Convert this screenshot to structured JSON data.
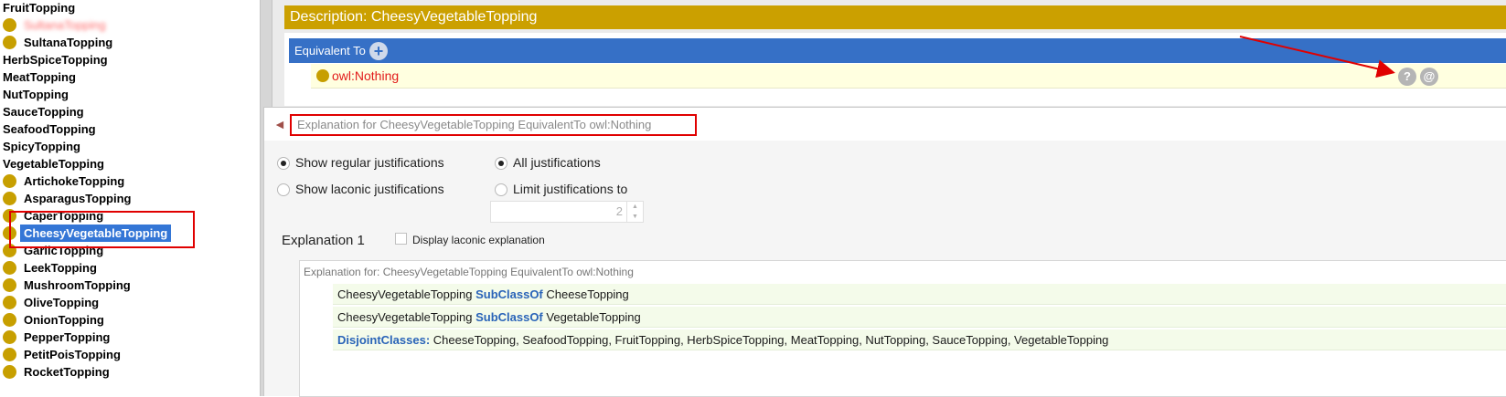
{
  "class_tree": {
    "items": [
      {
        "label": "FruitTopping",
        "dot": false,
        "top": true
      },
      {
        "label": "SultanaTopping",
        "dot": true,
        "blurred": true
      },
      {
        "label": "SultanaTopping",
        "dot": true
      },
      {
        "label": "HerbSpiceTopping",
        "dot": false,
        "top": true
      },
      {
        "label": "MeatTopping",
        "dot": false,
        "top": true
      },
      {
        "label": "NutTopping",
        "dot": false,
        "top": true
      },
      {
        "label": "SauceTopping",
        "dot": false,
        "top": true
      },
      {
        "label": "SeafoodTopping",
        "dot": false,
        "top": true
      },
      {
        "label": "SpicyTopping",
        "dot": false,
        "top": true
      },
      {
        "label": "VegetableTopping",
        "dot": false,
        "top": true
      },
      {
        "label": "ArtichokeTopping",
        "dot": true
      },
      {
        "label": "AsparagusTopping",
        "dot": true
      },
      {
        "label": "CaperTopping",
        "dot": true
      },
      {
        "label": "CheesyVegetableTopping",
        "dot": true,
        "selected": true
      },
      {
        "label": "GarlicTopping",
        "dot": true
      },
      {
        "label": "LeekTopping",
        "dot": true
      },
      {
        "label": "MushroomTopping",
        "dot": true
      },
      {
        "label": "OliveTopping",
        "dot": true
      },
      {
        "label": "OnionTopping",
        "dot": true
      },
      {
        "label": "PepperTopping",
        "dot": true
      },
      {
        "label": "PetitPoisTopping",
        "dot": true
      },
      {
        "label": "RocketTopping",
        "dot": true
      }
    ]
  },
  "description": {
    "title": "Description: CheesyVegetableTopping",
    "equivalent_to_label": "Equivalent To",
    "equivalent_value": "owl:Nothing",
    "help_button": "?",
    "at_button": "@"
  },
  "dialog": {
    "title": "Explanation for CheesyVegetableTopping EquivalentTo owl:Nothing",
    "show_regular": "Show regular justifications",
    "show_laconic": "Show laconic justifications",
    "all_justifications": "All justifications",
    "limit_justifications": "Limit justifications to",
    "limit_value": "2",
    "explanation_heading": "Explanation 1",
    "display_laconic": "Display laconic explanation",
    "explanation_for": "Explanation for: CheesyVegetableTopping EquivalentTo owl:Nothing",
    "axioms": [
      {
        "subject": "CheesyVegetableTopping",
        "keyword": "SubClassOf",
        "object": "CheeseTopping"
      },
      {
        "subject": "CheesyVegetableTopping",
        "keyword": "SubClassOf",
        "object": "VegetableTopping"
      },
      {
        "subject": "",
        "keyword": "DisjointClasses:",
        "object": "CheeseTopping, SeafoodTopping, FruitTopping, HerbSpiceTopping, MeatTopping, NutTopping, SauceTopping, VegetableTopping"
      }
    ]
  },
  "colors": {
    "class_dot": "#c79f00",
    "header_blue": "#3670c6",
    "description_gold": "#cba000",
    "selection_blue": "#3476d6",
    "annotation_red": "#e00000"
  }
}
